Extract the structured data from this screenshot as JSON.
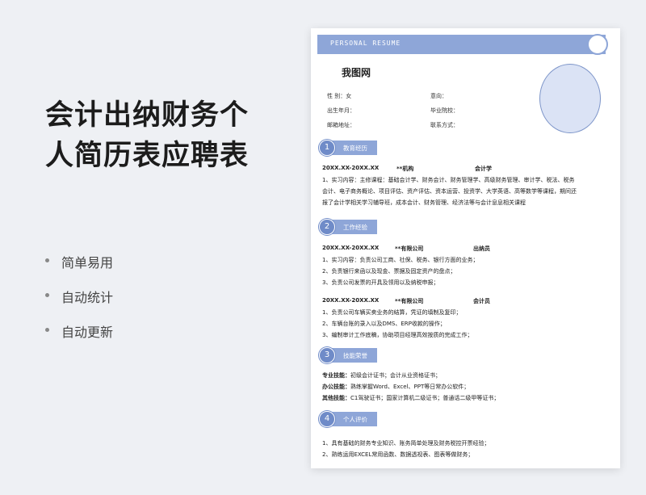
{
  "left": {
    "title_line1": "会计出纳财务个",
    "title_line2": "人简历表应聘表",
    "features": [
      "简单易用",
      "自动统计",
      "自动更新"
    ]
  },
  "resume": {
    "header": "PERSONAL   RESUME",
    "name": "我图网",
    "info": {
      "gender": "性        别：女",
      "intent": "意向：",
      "birth": "出生年月：",
      "school": "毕业院校：",
      "email": "邮箱地址：",
      "contact": "联系方式："
    },
    "sections": [
      {
        "num": "1",
        "title": "教育经历"
      },
      {
        "num": "2",
        "title": "工作经验"
      },
      {
        "num": "3",
        "title": "技能荣誉"
      },
      {
        "num": "4",
        "title": "个人评价"
      }
    ],
    "education": {
      "date": "20XX.XX-20XX.XX",
      "org": "**机构",
      "major": "会计学",
      "lines": [
        "1、实习内容：主修课程：基础会计学、财务会计、财务管理学、高级财务管理、审计学、税法、税务",
        "会计、电子商务概论、项目评估、资产评估、资本运营、投资学、大学英语、高等数学等课程，期间还",
        "报了会计学相关学习辅导班，成本会计、财务管理、经济法等与会计息息相关课程"
      ]
    },
    "work1": {
      "date": "20XX.XX-20XX.XX",
      "org": "**有限公司",
      "role": "出纳员",
      "lines": [
        "1、实习内容：负责公司工商、社保、税务、银行方面的业务；",
        "2、负责银行来函以及现金、票据及固定资产的盘点；",
        "3、负责公司发票的开具及领用以及纳税申报；"
      ]
    },
    "work2": {
      "date": "20XX.XX-20XX.XX",
      "org": "**有限公司",
      "role": "会计员",
      "lines": [
        "1、负责公司车辆买卖业务的结算，凭证的填制及复印；",
        "2、车辆台账的录入以及DMS、ERP收款的操作；",
        "3、编制审计工作底稿，协助项目经理高效按质的完成工作；"
      ]
    },
    "skills": [
      {
        "label": "专业技能：",
        "text": "初级会计证书；会计从业资格证书；"
      },
      {
        "label": "办公技能：",
        "text": "熟练掌握Word、Excel、PPT等日常办公软件；"
      },
      {
        "label": "其他技能：",
        "text": "C1驾驶证书；国家计算机二级证书；普通话二级甲等证书；"
      }
    ],
    "evaluation": [
      "1、具有基础的财务专业知识、账务简单处理及财务税控开票经验；",
      "2、熟练运用EXCEL常用函数、数据透视表、图表等做财务；"
    ]
  }
}
